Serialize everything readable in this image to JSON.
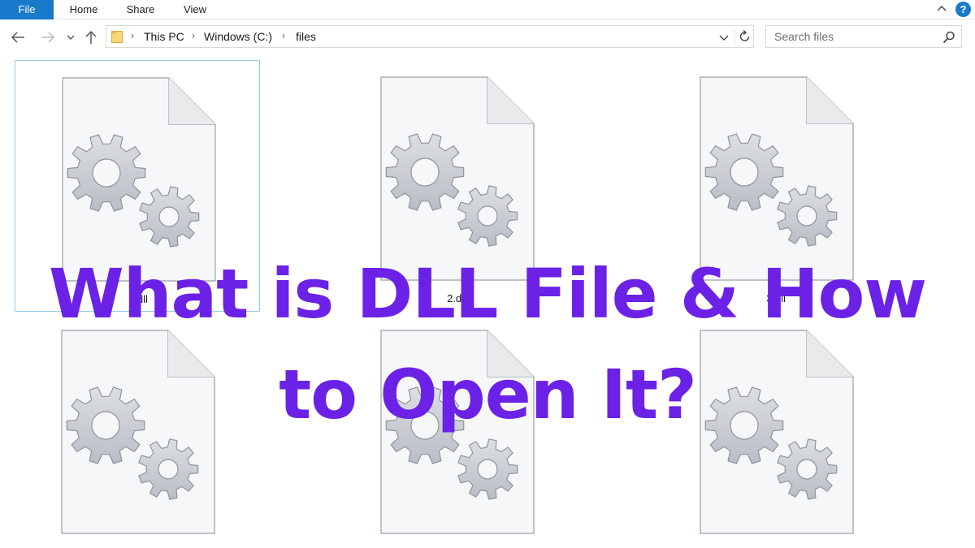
{
  "ribbon": {
    "tabs": [
      {
        "label": "File"
      },
      {
        "label": "Home"
      },
      {
        "label": "Share"
      },
      {
        "label": "View"
      }
    ],
    "help_label": "?"
  },
  "address": {
    "breadcrumbs": [
      "This PC",
      "Windows (C:)",
      "files"
    ]
  },
  "search": {
    "placeholder": "Search files"
  },
  "files": [
    {
      "name": "1.dll",
      "selected": true
    },
    {
      "name": "2.dll",
      "selected": false
    },
    {
      "name": "3.dll",
      "selected": false
    },
    {
      "name": "",
      "selected": false
    },
    {
      "name": "",
      "selected": false
    },
    {
      "name": "",
      "selected": false
    }
  ],
  "overlay": {
    "line1": "What is DLL File & How",
    "line2": "to Open It?"
  },
  "colors": {
    "ribbon_accent": "#1979ca",
    "overlay_text": "#6b21e6",
    "selection_border": "#99cdf0"
  }
}
